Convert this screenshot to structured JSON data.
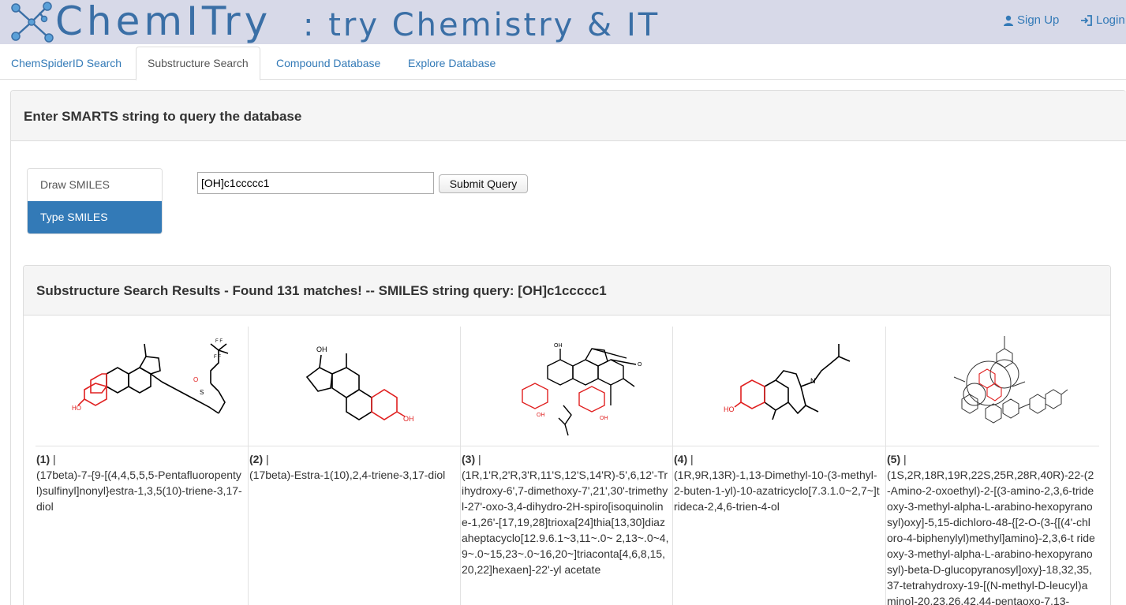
{
  "header": {
    "brand": "ChemITry",
    "tagline": ":  try Chemistry & IT",
    "signup_label": "Sign Up",
    "login_label": "Login",
    "accent_color": "#337ab7",
    "header_bg": "#d7d9e8"
  },
  "tabs": [
    {
      "label": "ChemSpiderID Search",
      "active": false
    },
    {
      "label": "Substructure Search",
      "active": true
    },
    {
      "label": "Compound Database",
      "active": false
    },
    {
      "label": "Explore Database",
      "active": false
    }
  ],
  "query_panel": {
    "title": "Enter SMARTS string to query the database",
    "modes": [
      {
        "label": "Draw SMILES",
        "active": false
      },
      {
        "label": "Type SMILES",
        "active": true
      }
    ],
    "smiles_value": "[OH]c1ccccc1",
    "submit_label": "Submit Query"
  },
  "results": {
    "title": "Substructure Search Results - Found 131 matches! -- SMILES string query: [OH]c1ccccc1",
    "items": [
      {
        "index": "(1)",
        "sep": " |",
        "name": "(17beta)-7-{9-[(4,4,5,5,5-Pentafluoropentyl)sulfinyl]nonyl}estra-1,3,5(10)-triene-3,17-diol"
      },
      {
        "index": "(2)",
        "sep": " |",
        "name": "(17beta)-Estra-1(10),2,4-triene-3,17-diol"
      },
      {
        "index": "(3)",
        "sep": " |",
        "name": "(1R,1'R,2'R,3'R,11'S,12'S,14'R)-5',6,12'-Trihydroxy-6',7-dimethoxy-7',21',30'-trimethyl-27'-oxo-3,4-dihydro-2H-spiro[isoquinoline-1,26'-[17,19,28]trioxa[24]thia[13,30]diazaheptacyclo[12.9.6.1~3,11~.0~ 2,13~.0~4,9~.0~15,23~.0~16,20~]triaconta[4,6,8,15,20,22]hexaen]-22'-yl acetate"
      },
      {
        "index": "(4)",
        "sep": " |",
        "name": "(1R,9R,13R)-1,13-Dimethyl-10-(3-methyl-2-buten-1-yl)-10-azatricyclo[7.3.1.0~2,7~]trideca-2,4,6-trien-4-ol"
      },
      {
        "index": "(5)",
        "sep": " |",
        "name": "(1S,2R,18R,19R,22S,25R,28R,40R)-22-(2-Amino-2-oxoethyl)-2-[(3-amino-2,3,6-trideoxy-3-methyl-alpha-L-arabino-hexopyranosyl)oxy]-5,15-dichloro-48-{[2-O-(3-{[(4'-chloro-4-biphenylyl)methyl]amino}-2,3,6-t rideoxy-3-methyl-alpha-L-arabino-hexopyranosyl)-beta-D-glucopyranosyl]oxy}-18,32,35,37-tetrahydroxy-19-[(N-methyl-D-leucyl)amino]-20,23,26,42,44-pentaoxo-7,13-"
      }
    ]
  }
}
